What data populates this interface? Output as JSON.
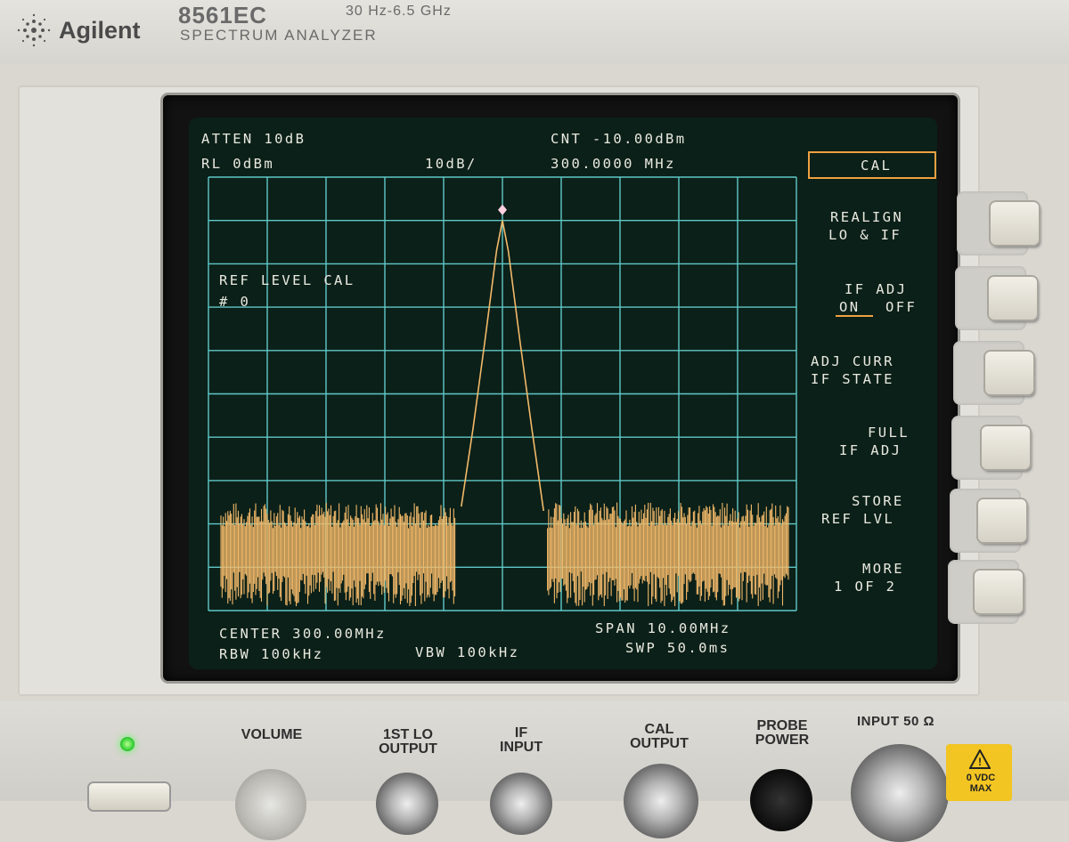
{
  "header": {
    "brand": "Agilent",
    "model": "8561EC",
    "freq_range": "30 Hz-6.5 GHz",
    "subtitle": "SPECTRUM ANALYZER"
  },
  "screen": {
    "atten": "ATTEN 10dB",
    "ref_level": "RL 0dBm",
    "scale": "10dB/",
    "counter_level": "CNT -10.00dBm",
    "counter_freq": "300.0000 MHz",
    "message_line1": "REF LEVEL CAL",
    "message_line2": "# 0",
    "center": "CENTER 300.00MHz",
    "span": "SPAN 10.00MHz",
    "rbw": "RBW 100kHz",
    "vbw": "VBW 100kHz",
    "sweep": "SWP 50.0ms",
    "menu_title": "CAL",
    "softkeys": [
      {
        "line1": "REALIGN",
        "line2": "LO & IF"
      },
      {
        "line1": "IF ADJ",
        "line2_on": "ON",
        "line2_off": "OFF"
      },
      {
        "line1": "ADJ CURR",
        "line2": "IF STATE"
      },
      {
        "line1": "FULL",
        "line2": "IF ADJ"
      },
      {
        "line1": "STORE",
        "line2": "REF LVL"
      },
      {
        "line1": "MORE",
        "line2": "1 OF 2"
      }
    ],
    "colors": {
      "grid": "#5fc8c8",
      "trace": "#f2b96a",
      "text": "#e9e9e0",
      "menu_box": "#f0a040",
      "marker": "#ffd0e0",
      "screen_bg": "#0b2018"
    }
  },
  "front_panel": {
    "volume": "VOLUME",
    "lo_output": "1ST LO\nOUTPUT",
    "if_input": "IF\nINPUT",
    "cal_output": "CAL\nOUTPUT",
    "probe_power": "PROBE\nPOWER",
    "input": "INPUT 50 Ω",
    "warning": "0 VDC\nMAX"
  },
  "chart_data": {
    "type": "line",
    "title": "",
    "x_label": "",
    "y_label": "",
    "x_range_mhz": [
      295,
      305
    ],
    "y_range_dbm": [
      -100,
      0
    ],
    "center_mhz": 300.0,
    "span_mhz": 10.0,
    "peak": {
      "x_mhz": 300.0,
      "y_dbm": -10.0
    },
    "noise_floor_dbm": [
      -78,
      -95
    ],
    "series": [
      {
        "x_mhz": [
          295.0,
          295.5,
          296.0,
          296.5,
          297.0,
          297.5,
          298.0,
          298.5,
          299.0,
          299.3,
          299.5,
          299.7,
          299.9,
          300.0,
          300.1,
          300.3,
          300.5,
          300.7,
          301.0,
          301.5,
          302.0,
          302.5,
          303.0,
          303.5,
          304.0,
          304.5,
          305.0
        ],
        "y_dbm": [
          -82,
          -84,
          -80,
          -83,
          -81,
          -84,
          -80,
          -82,
          -85,
          -76,
          -58,
          -38,
          -17,
          -10,
          -17,
          -38,
          -58,
          -77,
          -82,
          -80,
          -81,
          -79,
          -80,
          -78,
          -81,
          -80,
          -79
        ]
      }
    ]
  }
}
